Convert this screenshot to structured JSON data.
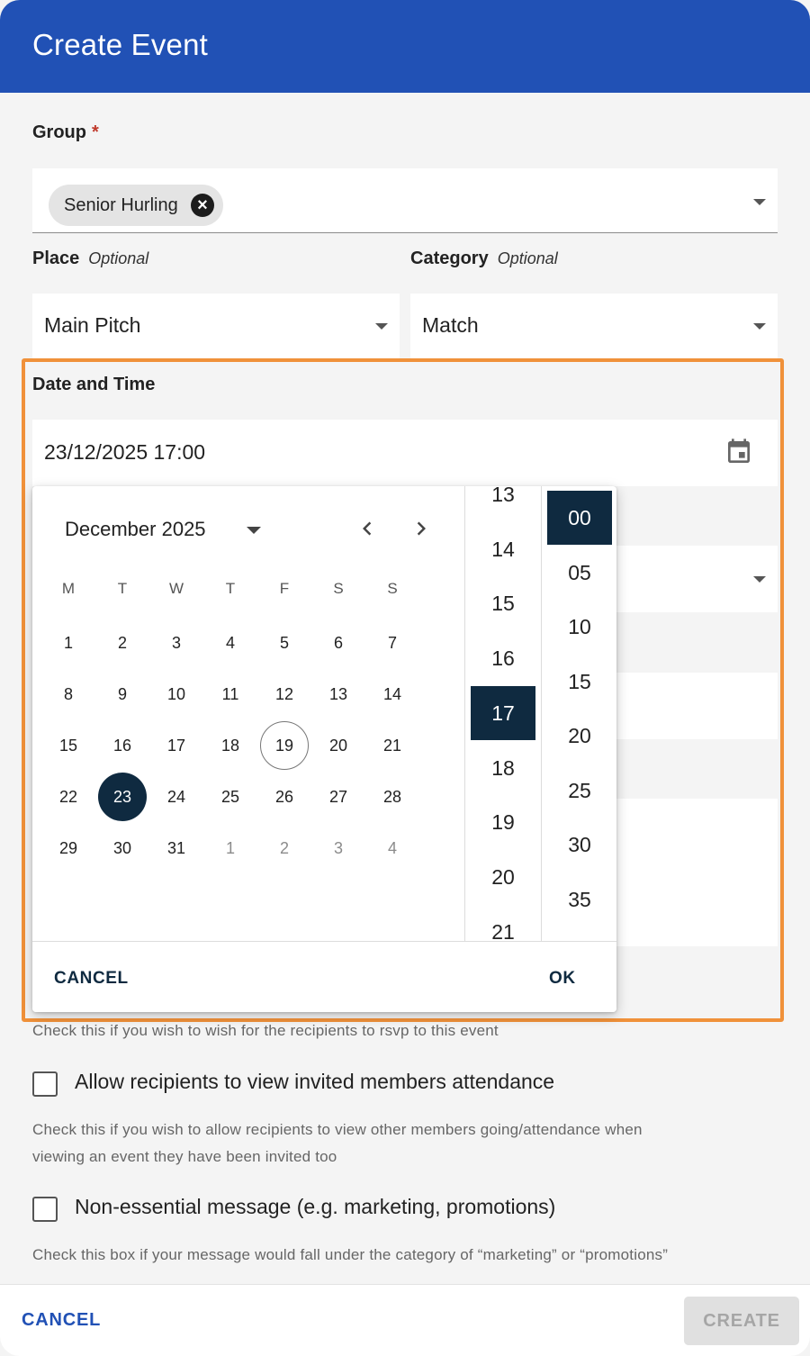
{
  "dialog": {
    "title": "Create Event"
  },
  "group": {
    "label": "Group",
    "required_mark": "*",
    "chip": "Senior Hurling"
  },
  "place": {
    "label": "Place",
    "optional": "Optional",
    "value": "Main Pitch"
  },
  "category": {
    "label": "Category",
    "optional": "Optional",
    "value": "Match"
  },
  "datetime": {
    "label": "Date and Time",
    "value": "23/12/2025 17:00"
  },
  "picker": {
    "month": "December 2025",
    "weekdays": [
      "M",
      "T",
      "W",
      "T",
      "F",
      "S",
      "S"
    ],
    "weeks": [
      [
        "1",
        "2",
        "3",
        "4",
        "5",
        "6",
        "7"
      ],
      [
        "8",
        "9",
        "10",
        "11",
        "12",
        "13",
        "14"
      ],
      [
        "15",
        "16",
        "17",
        "18",
        "19",
        "20",
        "21"
      ],
      [
        "22",
        "23",
        "24",
        "25",
        "26",
        "27",
        "28"
      ],
      [
        "29",
        "30",
        "31",
        "1",
        "2",
        "3",
        "4"
      ]
    ],
    "today": "19",
    "selected_day": "23",
    "hours": [
      "13",
      "14",
      "15",
      "16",
      "17",
      "18",
      "19",
      "20",
      "21"
    ],
    "selected_hour": "17",
    "minutes": [
      "00",
      "05",
      "10",
      "15",
      "20",
      "25",
      "30",
      "35"
    ],
    "selected_minute": "00",
    "cancel_label": "CANCEL",
    "ok_label": "OK"
  },
  "rsvp_helper": "Check this if you wish to wish for the recipients to rsvp to this event",
  "attendance": {
    "label": "Allow recipients to view invited members attendance",
    "checked": false,
    "helper_line1": "Check this if you wish to allow recipients to view other members going/attendance when",
    "helper_line2": "viewing an event they have been invited too"
  },
  "nonessential": {
    "label": "Non-essential message (e.g. marketing, promotions)",
    "checked": false,
    "helper": "Check this box if your message would fall under the category of “marketing” or “promotions”"
  },
  "footer": {
    "cancel_label": "CANCEL",
    "create_label": "CREATE"
  },
  "colors": {
    "header": "#2151b5",
    "selected": "#0f2a40",
    "highlight": "#f0913a"
  }
}
